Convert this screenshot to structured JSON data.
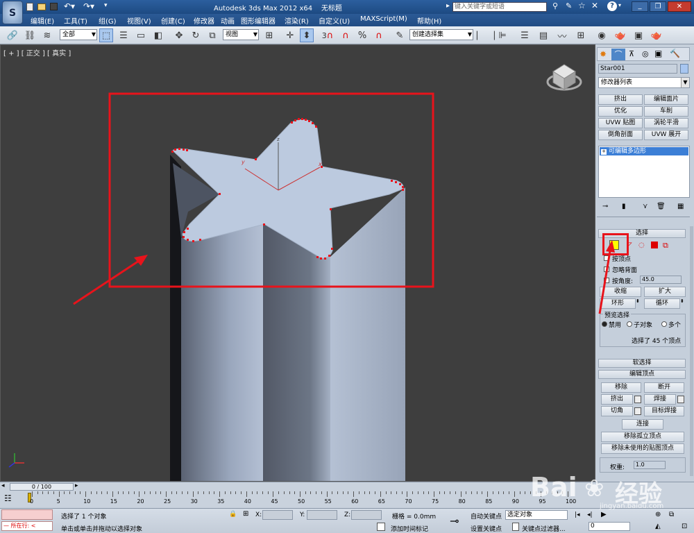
{
  "app": {
    "title": "Autodesk 3ds Max  2012 x64",
    "document": "无标题",
    "search_placeholder": "键入关键字或短语"
  },
  "menu": [
    "编辑(E)",
    "工具(T)",
    "组(G)",
    "视图(V)",
    "创建(C)",
    "修改器",
    "动画",
    "图形编辑器",
    "渲染(R)",
    "自定义(U)",
    "MAXScript(M)",
    "帮助(H)"
  ],
  "toolbar": {
    "filter_select": "全部",
    "ref_coord_select": "视图",
    "named_selection": "创建选择集",
    "snap_label": "3"
  },
  "viewport": {
    "label": "[ + ] [ 正交 ] [ 真实 ]",
    "gizmo_x": "x",
    "gizmo_y": "y",
    "gizmo_z": "z"
  },
  "command_panel": {
    "object_name": "Star001",
    "modifier_list": "修改器列表",
    "modifier_buttons": [
      "挤出",
      "编辑面片",
      "优化",
      "车削",
      "UVW 贴图",
      "涡轮平滑",
      "倒角剖面",
      "UVW 展开"
    ],
    "stack_item": "可编辑多边形",
    "selection_rollout": "选择",
    "by_vertex": "按顶点",
    "ignore_backfacing": "忽略背面",
    "by_angle": "按角度:",
    "angle_value": "45.0",
    "shrink": "收缩",
    "grow": "扩大",
    "ring": "环形",
    "loop": "循环",
    "preview_selection": "预览选择",
    "preview_options": [
      "禁用",
      "子对象",
      "多个"
    ],
    "selection_info": "选择了 45 个顶点",
    "soft_selection": "软选择",
    "edit_vertices": "编辑顶点",
    "remove": "移除",
    "break": "断开",
    "extrude": "挤出",
    "weld": "焊接",
    "chamfer": "切角",
    "target_weld": "目标焊接",
    "connect": "连接",
    "remove_isolated": "移除孤立顶点",
    "remove_unused_map": "移除未使用的贴图顶点",
    "weight_label": "权重:",
    "weight_value": "1.0"
  },
  "timeline": {
    "frame_counter": "0 / 100",
    "ticks": [
      "0",
      "5",
      "10",
      "15",
      "20",
      "25",
      "30",
      "35",
      "40",
      "45",
      "50",
      "55",
      "60",
      "65",
      "70",
      "75",
      "80",
      "85",
      "90",
      "95",
      "100"
    ]
  },
  "status": {
    "mode": "所在行:",
    "selected": "选择了 1 个对象",
    "prompt": "单击或单击并拖动以选择对象",
    "x_label": "X:",
    "y_label": "Y:",
    "z_label": "Z:",
    "grid": "栅格 = 0.0mm",
    "add_time_tag": "添加时间标记",
    "auto_key": "自动关键点",
    "set_key": "设置关键点",
    "selected_object": "选定对象",
    "key_filters": "关键点过滤器...",
    "frame_value": "0"
  },
  "watermark": {
    "brand": "Bai",
    "brand2": "经验",
    "url": "jingyan.baidu.com"
  },
  "colors": {
    "highlight_red": "#e8131b",
    "selection_yellow": "#ffff00",
    "star_top": "#bccadf"
  }
}
